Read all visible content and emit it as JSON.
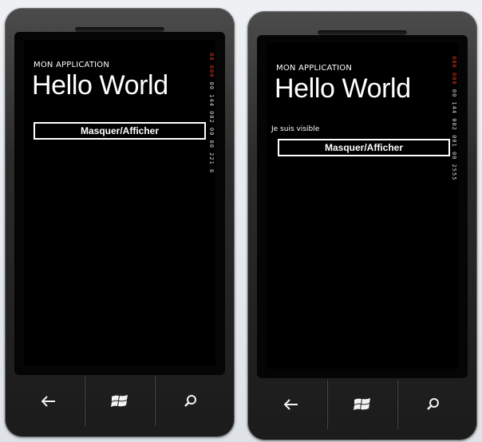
{
  "left_phone": {
    "app_title": "MON APPLICATION",
    "page_title": "Hello World",
    "toggle_button_label": "Masquer/Afficher",
    "counter_red": "00 000",
    "counter_white": "00 144 002 00 00 221 6"
  },
  "right_phone": {
    "app_title": "MON APPLICATION",
    "page_title": "Hello World",
    "status_text": "Je suis visible",
    "toggle_button_label": "Masquer/Afficher",
    "counter_red": "000 000",
    "counter_white": "00 144 002 001 00 2555"
  },
  "nav_keys": {
    "back": "back-arrow-icon",
    "start": "windows-logo-icon",
    "search": "search-icon"
  },
  "colors": {
    "screen_background": "#000000",
    "text": "#ffffff",
    "counter_accent": "#e03a1c"
  }
}
